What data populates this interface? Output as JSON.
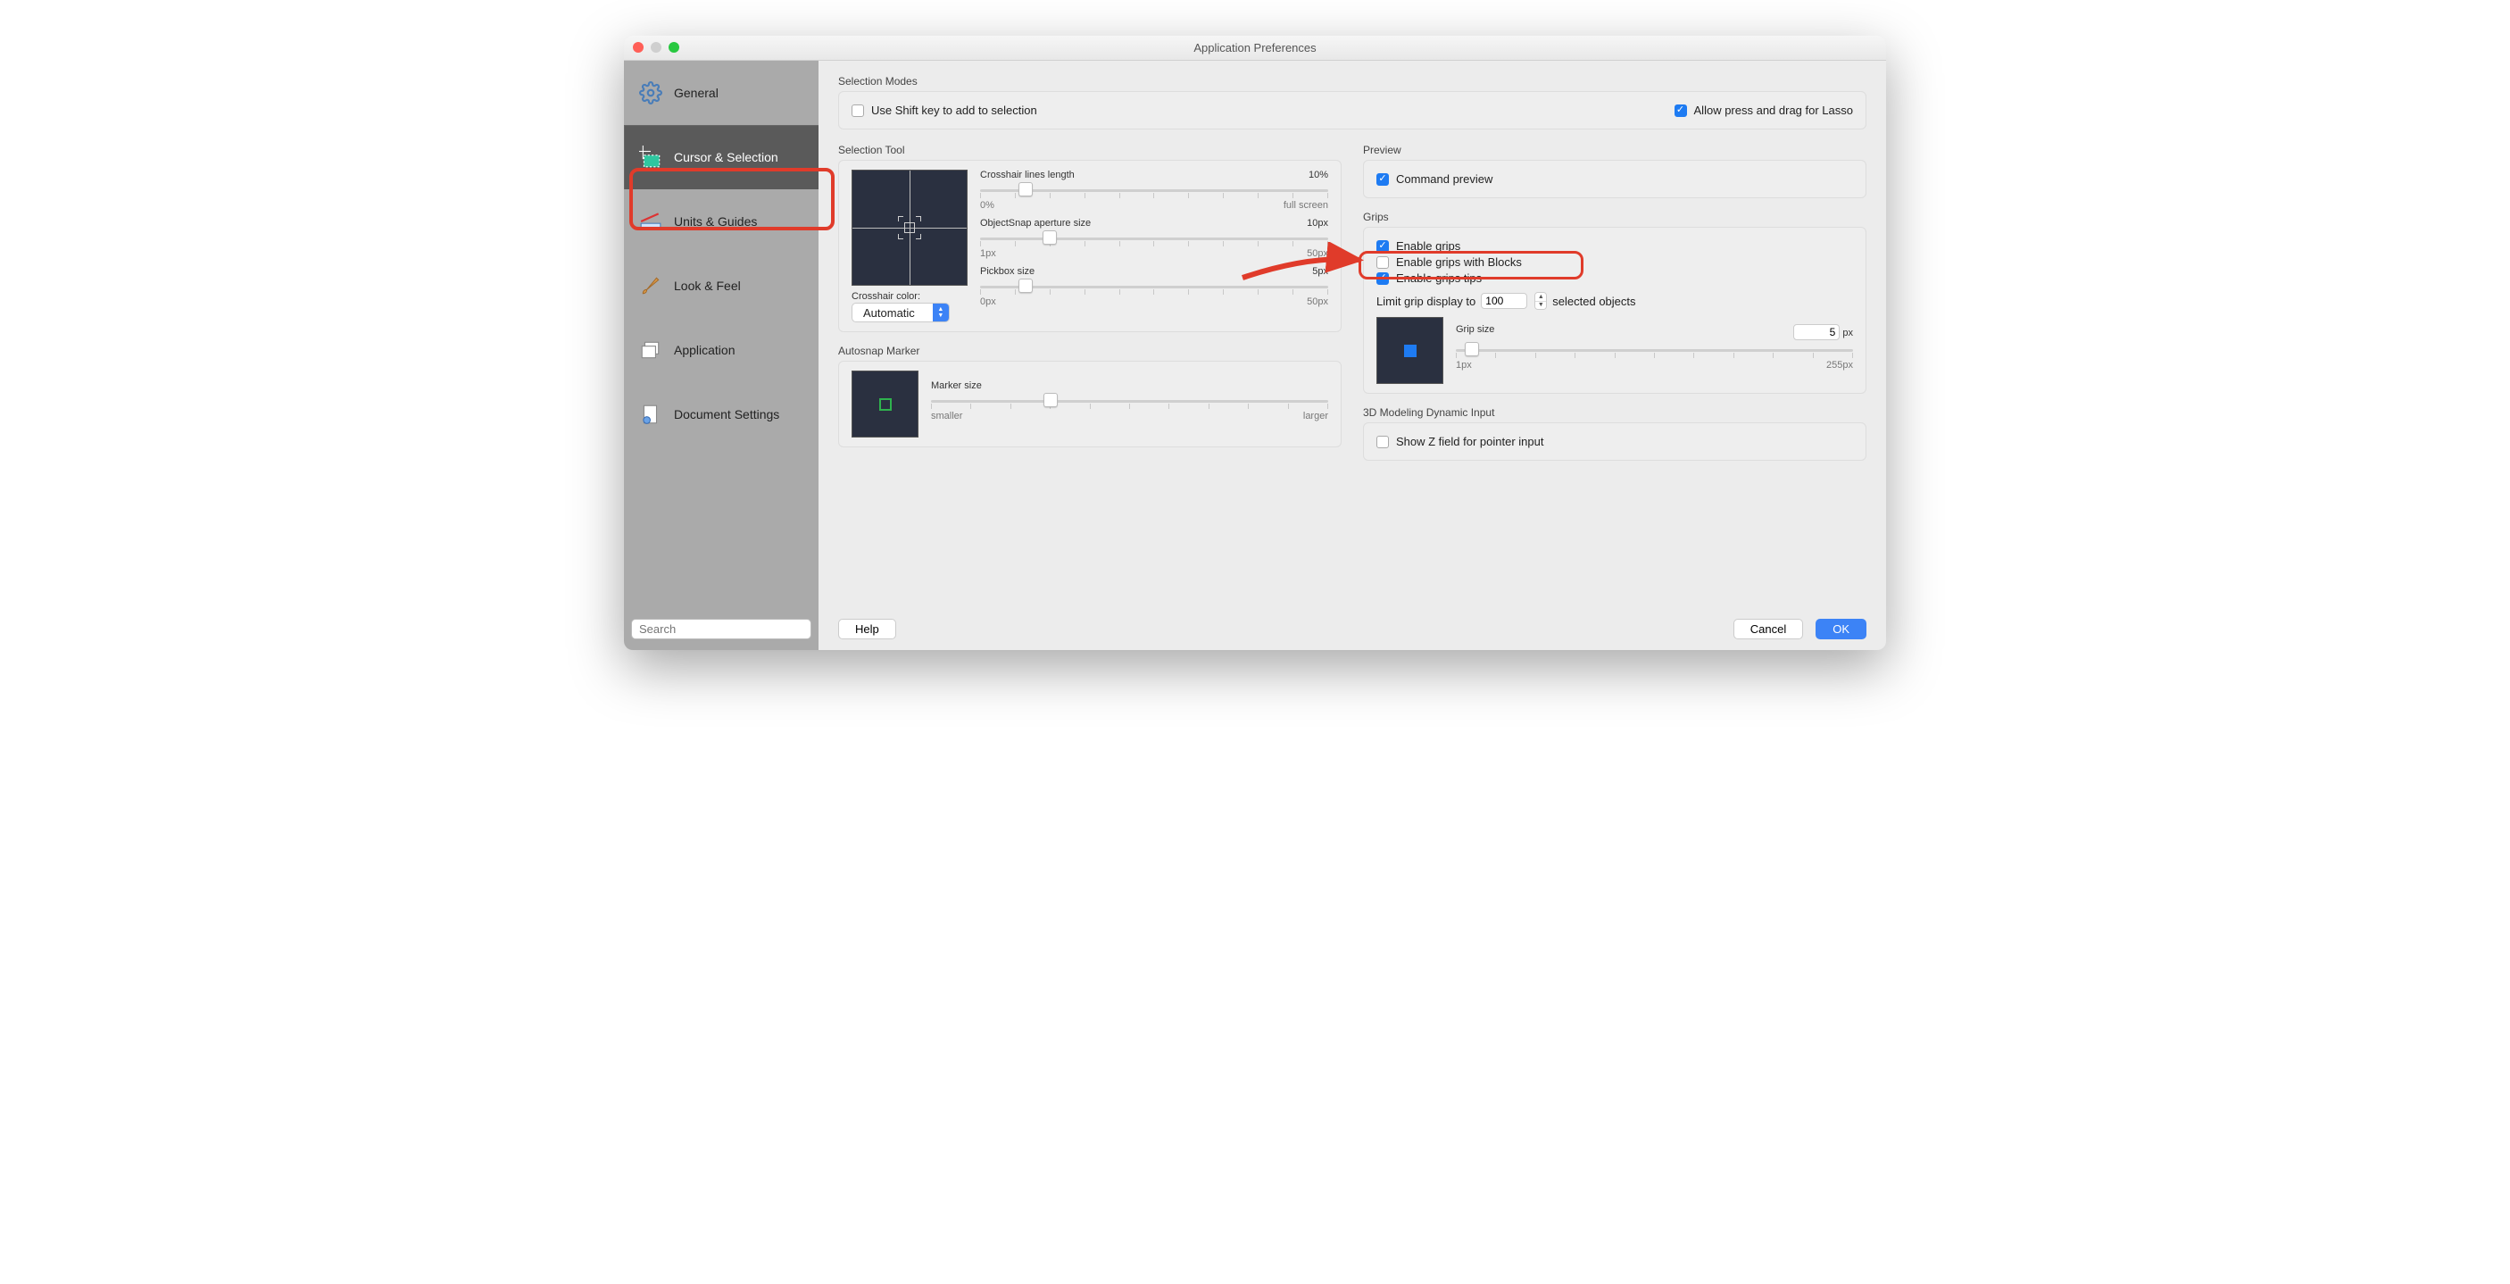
{
  "window": {
    "title": "Application Preferences"
  },
  "sidebar": {
    "items": [
      {
        "label": "General"
      },
      {
        "label": "Cursor & Selection"
      },
      {
        "label": "Units & Guides"
      },
      {
        "label": "Look & Feel"
      },
      {
        "label": "Application"
      },
      {
        "label": "Document Settings"
      }
    ],
    "search_placeholder": "Search"
  },
  "sections": {
    "selection_modes": {
      "title": "Selection Modes",
      "use_shift": "Use Shift key to add to selection",
      "allow_lasso": "Allow press and drag for Lasso"
    },
    "selection_tool": {
      "title": "Selection Tool",
      "crosshair_len_label": "Crosshair lines length",
      "crosshair_len_value": "10%",
      "crosshair_len_min": "0%",
      "crosshair_len_max": "full screen",
      "objectsnap_label": "ObjectSnap aperture size",
      "objectsnap_value": "10px",
      "objectsnap_min": "1px",
      "objectsnap_max": "50px",
      "pickbox_label": "Pickbox size",
      "pickbox_value": "5px",
      "pickbox_min": "0px",
      "pickbox_max": "50px",
      "crosshair_color_label": "Crosshair color:",
      "crosshair_color_value": "Automatic"
    },
    "autosnap": {
      "title": "Autosnap Marker",
      "marker_label": "Marker size",
      "marker_min": "smaller",
      "marker_max": "larger"
    },
    "preview": {
      "title": "Preview",
      "command_preview": "Command preview"
    },
    "grips": {
      "title": "Grips",
      "enable_grips": "Enable grips",
      "enable_grips_blocks": "Enable grips with Blocks",
      "enable_grips_tips": "Enable grips tips",
      "limit_pre": "Limit grip display to",
      "limit_value": "100",
      "limit_post": "selected objects",
      "grip_size_label": "Grip size",
      "grip_size_value": "5",
      "grip_size_unit": "px",
      "grip_size_min": "1px",
      "grip_size_max": "255px"
    },
    "dyn3d": {
      "title": "3D Modeling Dynamic Input",
      "show_z": "Show Z field for pointer input"
    }
  },
  "buttons": {
    "help": "Help",
    "cancel": "Cancel",
    "ok": "OK"
  }
}
